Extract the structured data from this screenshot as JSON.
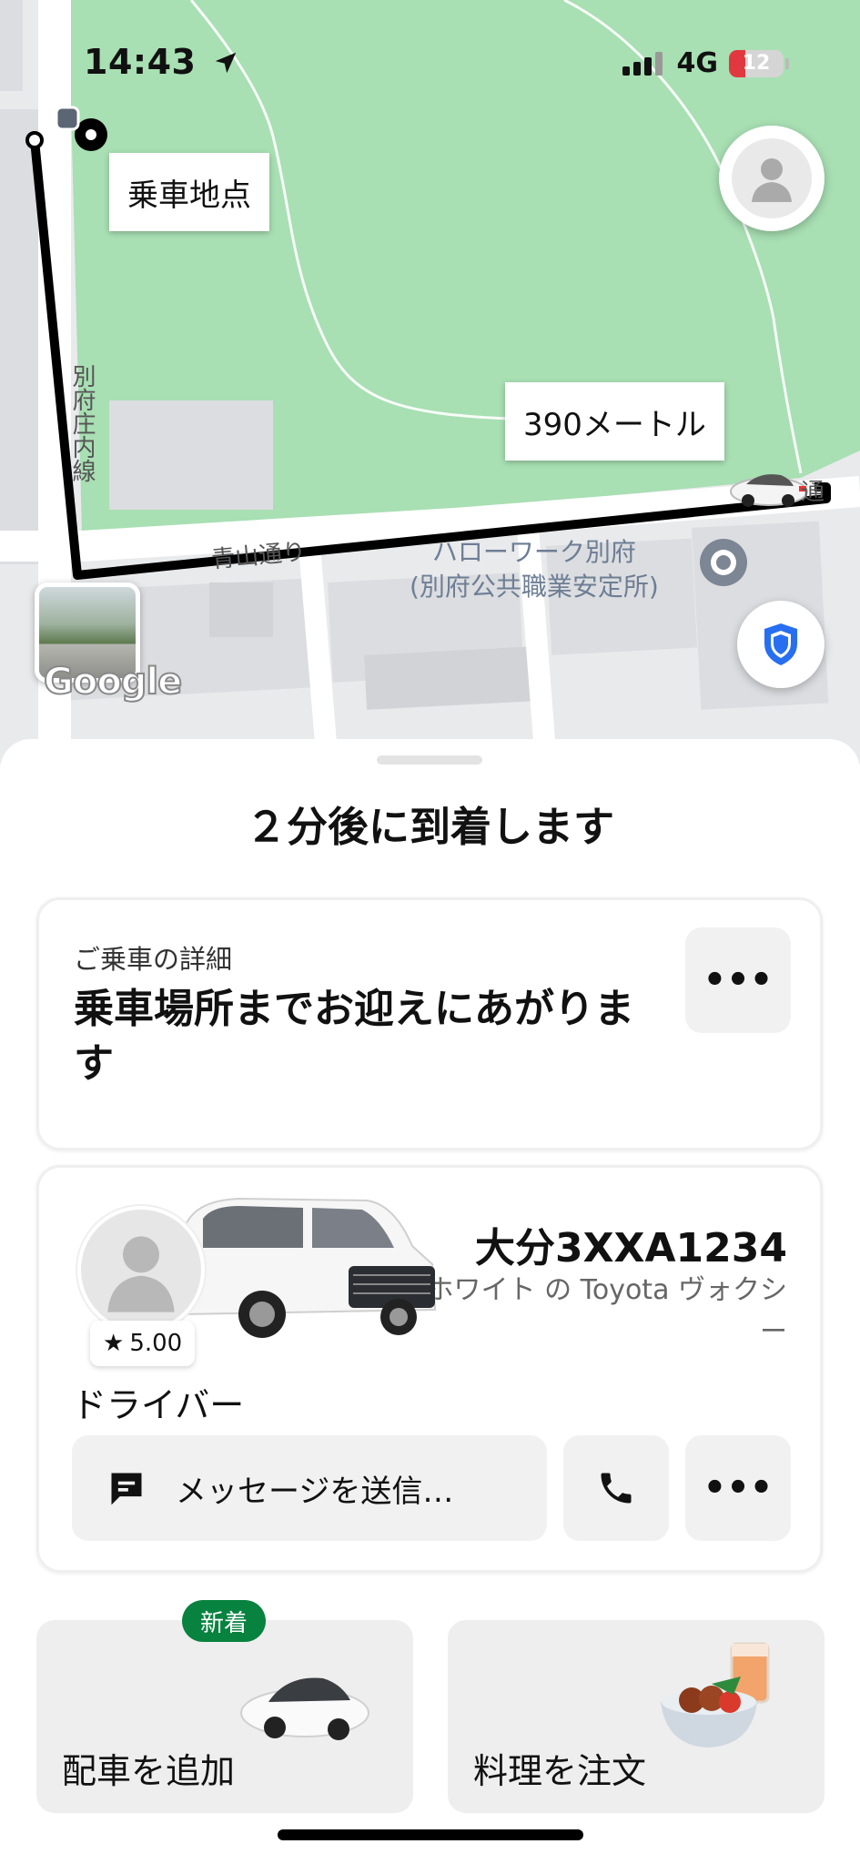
{
  "status_bar": {
    "time": "14:43",
    "network": "4G",
    "battery": "12",
    "battery_level_fraction": 0.12
  },
  "map": {
    "pickup_label": "乗車地点",
    "distance_label": "390メートル",
    "street_vertical": "別府庄内線",
    "street_aoyama": "青山通り",
    "street_right": "通",
    "poi_line1": "ハローワーク別府",
    "poi_line2": "(別府公共職業安定所)",
    "google_logo": "Google",
    "colors": {
      "park": "#a8dfb3",
      "road": "#ffffff",
      "route": "#000000",
      "building": "#dcdde0"
    }
  },
  "sheet": {
    "eta_title": "２分後に到着します",
    "ride_card": {
      "subtitle": "ご乗車の詳細",
      "message": "乗車場所までお迎えにあがります",
      "more_icon": "more-icon"
    },
    "driver_card": {
      "plate": "大分3XXA1234",
      "car_description": "ホワイト の Toyota ヴォクシー",
      "rating": "5.00",
      "driver_label": "ドライバー",
      "message_button": "メッセージを送信…",
      "icons": [
        "chat-icon",
        "phone-icon",
        "more-icon",
        "star-icon"
      ]
    },
    "tiles": [
      {
        "label": "配車を追加",
        "badge": "新着"
      },
      {
        "label": "料理を注文"
      }
    ]
  },
  "accent_colors": {
    "badge_green": "#07823f",
    "shield_blue": "#276ef1",
    "battery_red": "#e0383e"
  }
}
